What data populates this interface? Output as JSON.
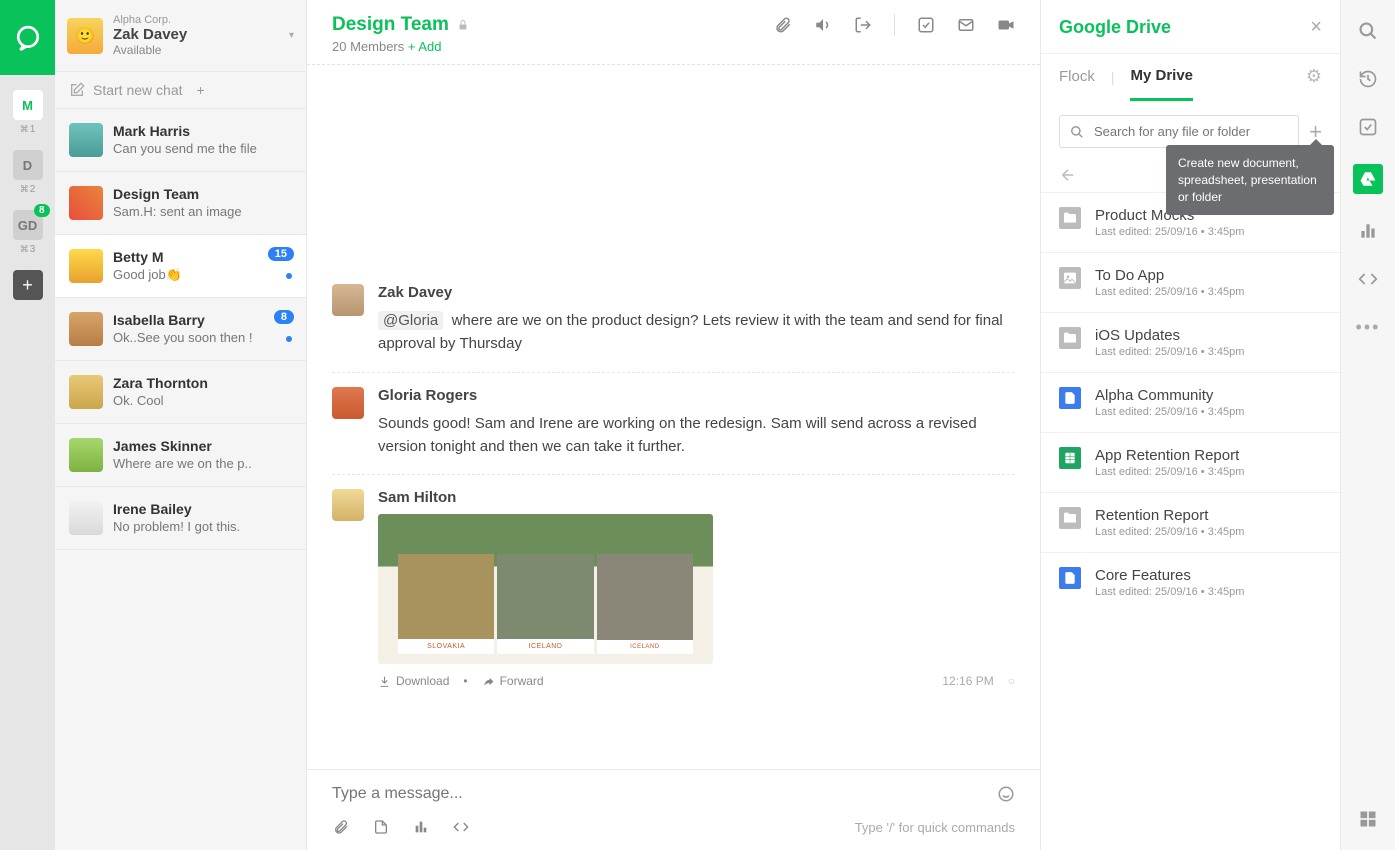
{
  "rail": {
    "items": [
      {
        "label": "M",
        "shortcut": "⌘1"
      },
      {
        "label": "D",
        "shortcut": "⌘2"
      },
      {
        "label": "GD",
        "shortcut": "⌘3",
        "badge": "8"
      }
    ]
  },
  "profile": {
    "org": "Alpha Corp.",
    "name": "Zak Davey",
    "status": "Available"
  },
  "new_chat": {
    "label": "Start new chat"
  },
  "conversations": [
    {
      "name": "Mark Harris",
      "preview": "Can you send me the file"
    },
    {
      "name": "Design Team",
      "preview": "Sam.H: sent an image"
    },
    {
      "name": "Betty M",
      "preview": "Good job👏",
      "badge": "15",
      "dot": true
    },
    {
      "name": "Isabella Barry",
      "preview": "Ok..See you soon then !",
      "badge": "8",
      "dot": true
    },
    {
      "name": "Zara Thornton",
      "preview": "Ok. Cool"
    },
    {
      "name": "James Skinner",
      "preview": "Where are we on the p.."
    },
    {
      "name": "Irene Bailey",
      "preview": "No problem! I got this."
    }
  ],
  "chat": {
    "title": "Design Team",
    "members": "20 Members",
    "add": "+ Add",
    "composer_placeholder": "Type a message...",
    "slash_hint": "Type '/' for quick commands"
  },
  "messages": [
    {
      "author": "Zak Davey",
      "mention": "@Gloria",
      "text": "where are we on the product design? Lets review it with the team and send for final approval by Thursday"
    },
    {
      "author": "Gloria Rogers",
      "text": "Sounds good! Sam and Irene are working on the redesign. Sam will send across a revised version tonight and then we can take it further."
    },
    {
      "author": "Sam Hilton",
      "image": true,
      "img_cards": [
        "SLOVAKIA",
        "ICELAND",
        "ICELAND"
      ],
      "download": "Download",
      "forward": "Forward",
      "time": "12:16 PM"
    }
  ],
  "drive": {
    "title": "Google Drive",
    "tabs": {
      "flock": "Flock",
      "mydrive": "My Drive"
    },
    "search_placeholder": "Search for any file or folder",
    "tooltip": "Create new document, spreadsheet, presentation or folder",
    "items": [
      {
        "name": "Product Mocks",
        "meta": "Last edited:   25/09/16   •   3:45pm",
        "kind": "folder"
      },
      {
        "name": "To Do App",
        "meta": "Last edited:   25/09/16   •   3:45pm",
        "kind": "img"
      },
      {
        "name": "iOS Updates",
        "meta": "Last edited:   25/09/16   •   3:45pm",
        "kind": "folder"
      },
      {
        "name": "Alpha Community",
        "meta": "Last edited:   25/09/16   •   3:45pm",
        "kind": "doc"
      },
      {
        "name": "App Retention Report",
        "meta": "Last edited:   25/09/16   •   3:45pm",
        "kind": "sheet"
      },
      {
        "name": "Retention Report",
        "meta": "Last edited:   25/09/16   •   3:45pm",
        "kind": "folder"
      },
      {
        "name": "Core Features",
        "meta": "Last edited:   25/09/16   •   3:45pm",
        "kind": "doc"
      }
    ]
  }
}
